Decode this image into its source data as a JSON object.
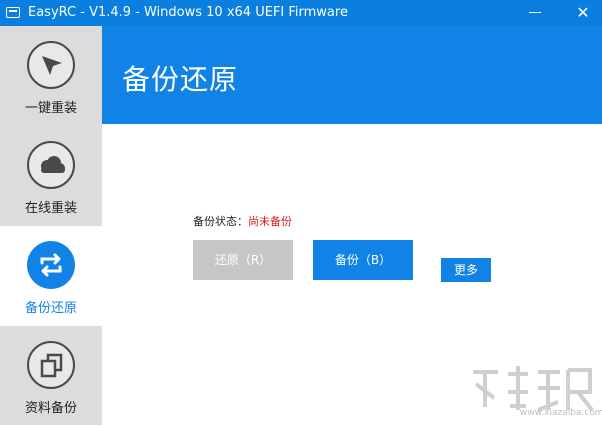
{
  "window": {
    "title": "EasyRC - V1.4.9 - Windows 10 x64 UEFI Firmware",
    "minimize": "—",
    "close": "✕"
  },
  "sidebar": {
    "items": [
      {
        "label": "一键重装",
        "icon": "cursor-arrow-icon",
        "active": false
      },
      {
        "label": "在线重装",
        "icon": "cloud-icon",
        "active": false
      },
      {
        "label": "备份还原",
        "icon": "sync-arrows-icon",
        "active": true
      },
      {
        "label": "资料备份",
        "icon": "copy-icon",
        "active": false
      }
    ]
  },
  "header": {
    "title": "备份还原"
  },
  "main": {
    "status_label": "备份状态：",
    "status_value": "尚未备份",
    "restore_label": "还原（R）",
    "backup_label": "备份（B）",
    "more_label": "更多"
  },
  "watermark": {
    "site": "www.xiazaiba.com"
  },
  "colors": {
    "accent": "#1183e6",
    "titlebar": "#0a7fe0",
    "sidebar_bg": "#dcdcdc",
    "status_red": "#d41a1a",
    "disabled_button": "#c6c6c6"
  }
}
